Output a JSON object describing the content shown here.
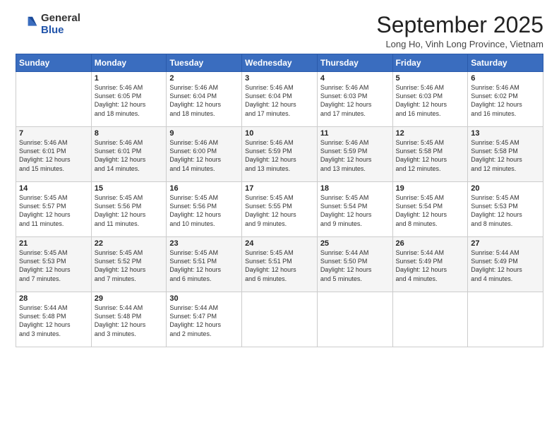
{
  "logo": {
    "general": "General",
    "blue": "Blue"
  },
  "header": {
    "month": "September 2025",
    "location": "Long Ho, Vinh Long Province, Vietnam"
  },
  "weekdays": [
    "Sunday",
    "Monday",
    "Tuesday",
    "Wednesday",
    "Thursday",
    "Friday",
    "Saturday"
  ],
  "weeks": [
    [
      {
        "day": "",
        "sunrise": "",
        "sunset": "",
        "daylight": ""
      },
      {
        "day": "1",
        "sunrise": "Sunrise: 5:46 AM",
        "sunset": "Sunset: 6:05 PM",
        "daylight": "Daylight: 12 hours and 18 minutes."
      },
      {
        "day": "2",
        "sunrise": "Sunrise: 5:46 AM",
        "sunset": "Sunset: 6:04 PM",
        "daylight": "Daylight: 12 hours and 18 minutes."
      },
      {
        "day": "3",
        "sunrise": "Sunrise: 5:46 AM",
        "sunset": "Sunset: 6:04 PM",
        "daylight": "Daylight: 12 hours and 17 minutes."
      },
      {
        "day": "4",
        "sunrise": "Sunrise: 5:46 AM",
        "sunset": "Sunset: 6:03 PM",
        "daylight": "Daylight: 12 hours and 17 minutes."
      },
      {
        "day": "5",
        "sunrise": "Sunrise: 5:46 AM",
        "sunset": "Sunset: 6:03 PM",
        "daylight": "Daylight: 12 hours and 16 minutes."
      },
      {
        "day": "6",
        "sunrise": "Sunrise: 5:46 AM",
        "sunset": "Sunset: 6:02 PM",
        "daylight": "Daylight: 12 hours and 16 minutes."
      }
    ],
    [
      {
        "day": "7",
        "sunrise": "Sunrise: 5:46 AM",
        "sunset": "Sunset: 6:01 PM",
        "daylight": "Daylight: 12 hours and 15 minutes."
      },
      {
        "day": "8",
        "sunrise": "Sunrise: 5:46 AM",
        "sunset": "Sunset: 6:01 PM",
        "daylight": "Daylight: 12 hours and 14 minutes."
      },
      {
        "day": "9",
        "sunrise": "Sunrise: 5:46 AM",
        "sunset": "Sunset: 6:00 PM",
        "daylight": "Daylight: 12 hours and 14 minutes."
      },
      {
        "day": "10",
        "sunrise": "Sunrise: 5:46 AM",
        "sunset": "Sunset: 5:59 PM",
        "daylight": "Daylight: 12 hours and 13 minutes."
      },
      {
        "day": "11",
        "sunrise": "Sunrise: 5:46 AM",
        "sunset": "Sunset: 5:59 PM",
        "daylight": "Daylight: 12 hours and 13 minutes."
      },
      {
        "day": "12",
        "sunrise": "Sunrise: 5:45 AM",
        "sunset": "Sunset: 5:58 PM",
        "daylight": "Daylight: 12 hours and 12 minutes."
      },
      {
        "day": "13",
        "sunrise": "Sunrise: 5:45 AM",
        "sunset": "Sunset: 5:58 PM",
        "daylight": "Daylight: 12 hours and 12 minutes."
      }
    ],
    [
      {
        "day": "14",
        "sunrise": "Sunrise: 5:45 AM",
        "sunset": "Sunset: 5:57 PM",
        "daylight": "Daylight: 12 hours and 11 minutes."
      },
      {
        "day": "15",
        "sunrise": "Sunrise: 5:45 AM",
        "sunset": "Sunset: 5:56 PM",
        "daylight": "Daylight: 12 hours and 11 minutes."
      },
      {
        "day": "16",
        "sunrise": "Sunrise: 5:45 AM",
        "sunset": "Sunset: 5:56 PM",
        "daylight": "Daylight: 12 hours and 10 minutes."
      },
      {
        "day": "17",
        "sunrise": "Sunrise: 5:45 AM",
        "sunset": "Sunset: 5:55 PM",
        "daylight": "Daylight: 12 hours and 9 minutes."
      },
      {
        "day": "18",
        "sunrise": "Sunrise: 5:45 AM",
        "sunset": "Sunset: 5:54 PM",
        "daylight": "Daylight: 12 hours and 9 minutes."
      },
      {
        "day": "19",
        "sunrise": "Sunrise: 5:45 AM",
        "sunset": "Sunset: 5:54 PM",
        "daylight": "Daylight: 12 hours and 8 minutes."
      },
      {
        "day": "20",
        "sunrise": "Sunrise: 5:45 AM",
        "sunset": "Sunset: 5:53 PM",
        "daylight": "Daylight: 12 hours and 8 minutes."
      }
    ],
    [
      {
        "day": "21",
        "sunrise": "Sunrise: 5:45 AM",
        "sunset": "Sunset: 5:53 PM",
        "daylight": "Daylight: 12 hours and 7 minutes."
      },
      {
        "day": "22",
        "sunrise": "Sunrise: 5:45 AM",
        "sunset": "Sunset: 5:52 PM",
        "daylight": "Daylight: 12 hours and 7 minutes."
      },
      {
        "day": "23",
        "sunrise": "Sunrise: 5:45 AM",
        "sunset": "Sunset: 5:51 PM",
        "daylight": "Daylight: 12 hours and 6 minutes."
      },
      {
        "day": "24",
        "sunrise": "Sunrise: 5:45 AM",
        "sunset": "Sunset: 5:51 PM",
        "daylight": "Daylight: 12 hours and 6 minutes."
      },
      {
        "day": "25",
        "sunrise": "Sunrise: 5:44 AM",
        "sunset": "Sunset: 5:50 PM",
        "daylight": "Daylight: 12 hours and 5 minutes."
      },
      {
        "day": "26",
        "sunrise": "Sunrise: 5:44 AM",
        "sunset": "Sunset: 5:49 PM",
        "daylight": "Daylight: 12 hours and 4 minutes."
      },
      {
        "day": "27",
        "sunrise": "Sunrise: 5:44 AM",
        "sunset": "Sunset: 5:49 PM",
        "daylight": "Daylight: 12 hours and 4 minutes."
      }
    ],
    [
      {
        "day": "28",
        "sunrise": "Sunrise: 5:44 AM",
        "sunset": "Sunset: 5:48 PM",
        "daylight": "Daylight: 12 hours and 3 minutes."
      },
      {
        "day": "29",
        "sunrise": "Sunrise: 5:44 AM",
        "sunset": "Sunset: 5:48 PM",
        "daylight": "Daylight: 12 hours and 3 minutes."
      },
      {
        "day": "30",
        "sunrise": "Sunrise: 5:44 AM",
        "sunset": "Sunset: 5:47 PM",
        "daylight": "Daylight: 12 hours and 2 minutes."
      },
      {
        "day": "",
        "sunrise": "",
        "sunset": "",
        "daylight": ""
      },
      {
        "day": "",
        "sunrise": "",
        "sunset": "",
        "daylight": ""
      },
      {
        "day": "",
        "sunrise": "",
        "sunset": "",
        "daylight": ""
      },
      {
        "day": "",
        "sunrise": "",
        "sunset": "",
        "daylight": ""
      }
    ]
  ]
}
